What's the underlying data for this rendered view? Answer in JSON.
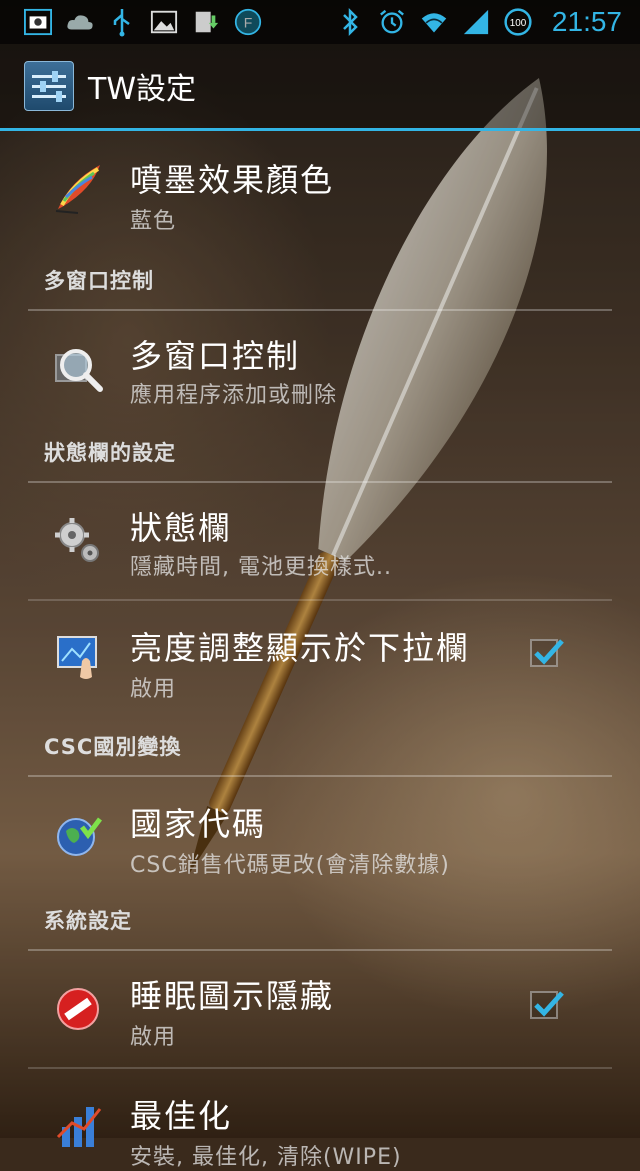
{
  "status_bar": {
    "time": "21:57",
    "battery": "100",
    "icons_left": [
      "screenshot-icon",
      "cloud-icon",
      "usb-icon",
      "image-icon",
      "download-icon",
      "f-circle-icon"
    ],
    "icons_right": [
      "bluetooth-icon",
      "alarm-icon",
      "wifi-icon",
      "signal-icon",
      "battery-icon"
    ]
  },
  "app_bar": {
    "title": "TW設定",
    "icon": "settings-sliders-icon"
  },
  "items": {
    "ink_color": {
      "title": "噴墨效果顏色",
      "summary": "藍色",
      "icon": "feather-pen-icon"
    },
    "section_multiwindow": {
      "label": "多窗口控制"
    },
    "multiwindow": {
      "title": "多窗口控制",
      "summary": "應用程序添加或刪除",
      "icon": "magnifier-chip-icon"
    },
    "section_statusbar": {
      "label": "狀態欄的設定"
    },
    "statusbar": {
      "title": "狀態欄",
      "summary": "隱藏時間, 電池更換樣式..",
      "icon": "gears-icon"
    },
    "brightness": {
      "title": "亮度調整顯示於下拉欄",
      "summary": "啟用",
      "icon": "touchscreen-icon",
      "checked": true
    },
    "section_csc": {
      "label": "CSC國別變換"
    },
    "country_code": {
      "title": "國家代碼",
      "summary": "CSC銷售代碼更改(會清除數據)",
      "icon": "globe-check-icon"
    },
    "section_system": {
      "label": "系統設定"
    },
    "sleep_icon": {
      "title": "睡眠圖示隱藏",
      "summary": "啟用",
      "icon": "no-entry-icon",
      "checked": true
    },
    "optimize": {
      "title": "最佳化",
      "summary": "安裝, 最佳化, 清除(WIPE)",
      "icon": "bar-chart-icon"
    }
  },
  "colors": {
    "accent": "#33b5e5",
    "check": "#33b5e5"
  }
}
